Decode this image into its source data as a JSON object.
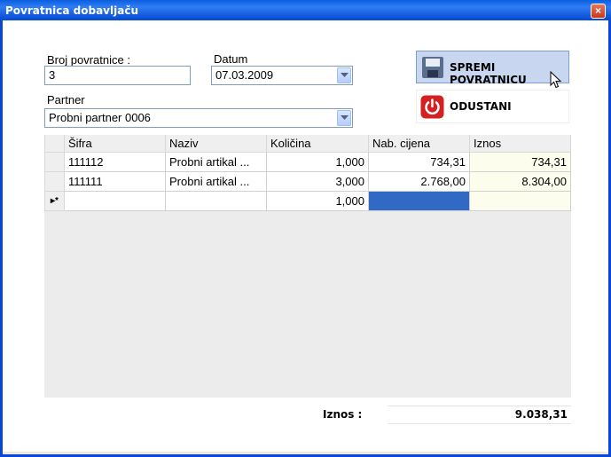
{
  "window": {
    "title": "Povratnica dobavljaču",
    "close_glyph": "×"
  },
  "form": {
    "broj_label": "Broj povratnice :",
    "broj_value": "3",
    "datum_label": "Datum",
    "datum_value": "07.03.2009",
    "partner_label": "Partner",
    "partner_value": "Probni partner 0006"
  },
  "buttons": {
    "save_label": "SPREMI POVRATNICU",
    "save_icon": "floppy-disk-icon",
    "cancel_label": "ODUSTANI",
    "cancel_icon": "power-icon"
  },
  "grid": {
    "columns": [
      "Šifra",
      "Naziv",
      "Količina",
      "Nab. cijena",
      "Iznos"
    ],
    "rows": [
      {
        "sifra": "111112",
        "naziv": "Probni artikal ...",
        "kolicina": "1,000",
        "cijena": "734,31",
        "iznos": "734,31"
      },
      {
        "sifra": "111111",
        "naziv": "Probni artikal ...",
        "kolicina": "3,000",
        "cijena": "2.768,00",
        "iznos": "8.304,00"
      }
    ],
    "new_row": {
      "indicator": "▸*",
      "kolicina": "1,000"
    }
  },
  "footer": {
    "total_label": "Iznos :",
    "total_value": "9.038,31"
  },
  "colors": {
    "titlebar": "#0a5fe0",
    "selected_cell": "#316ac5",
    "save_button_bg": "#c8d6f0",
    "power_icon": "#d42020"
  }
}
